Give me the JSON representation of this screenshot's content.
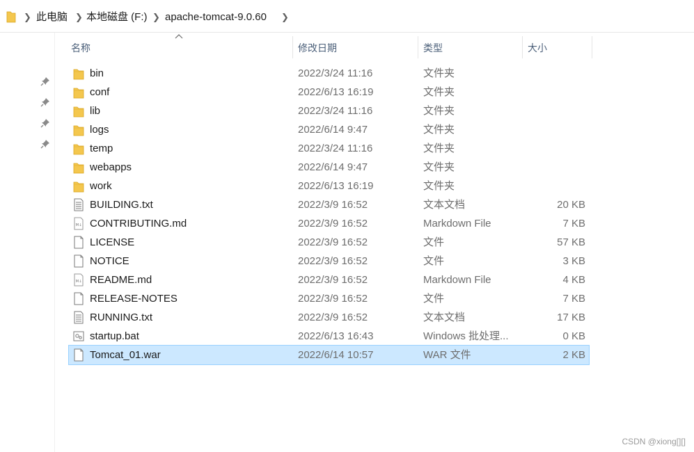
{
  "breadcrumb": {
    "items": [
      "此电脑",
      "本地磁盘 (F:)",
      "apache-tomcat-9.0.60"
    ]
  },
  "columns": {
    "name": "名称",
    "date": "修改日期",
    "type": "类型",
    "size": "大小"
  },
  "files": [
    {
      "name": "bin",
      "date": "2022/3/24 11:16",
      "type": "文件夹",
      "size": "",
      "icon": "folder-icon"
    },
    {
      "name": "conf",
      "date": "2022/6/13 16:19",
      "type": "文件夹",
      "size": "",
      "icon": "folder-icon"
    },
    {
      "name": "lib",
      "date": "2022/3/24 11:16",
      "type": "文件夹",
      "size": "",
      "icon": "folder-icon"
    },
    {
      "name": "logs",
      "date": "2022/6/14 9:47",
      "type": "文件夹",
      "size": "",
      "icon": "folder-icon"
    },
    {
      "name": "temp",
      "date": "2022/3/24 11:16",
      "type": "文件夹",
      "size": "",
      "icon": "folder-icon"
    },
    {
      "name": "webapps",
      "date": "2022/6/14 9:47",
      "type": "文件夹",
      "size": "",
      "icon": "folder-icon"
    },
    {
      "name": "work",
      "date": "2022/6/13 16:19",
      "type": "文件夹",
      "size": "",
      "icon": "folder-icon"
    },
    {
      "name": "BUILDING.txt",
      "date": "2022/3/9 16:52",
      "type": "文本文档",
      "size": "20 KB",
      "icon": "text-file-icon"
    },
    {
      "name": "CONTRIBUTING.md",
      "date": "2022/3/9 16:52",
      "type": "Markdown File",
      "size": "7 KB",
      "icon": "markdown-file-icon"
    },
    {
      "name": "LICENSE",
      "date": "2022/3/9 16:52",
      "type": "文件",
      "size": "57 KB",
      "icon": "blank-file-icon"
    },
    {
      "name": "NOTICE",
      "date": "2022/3/9 16:52",
      "type": "文件",
      "size": "3 KB",
      "icon": "blank-file-icon"
    },
    {
      "name": "README.md",
      "date": "2022/3/9 16:52",
      "type": "Markdown File",
      "size": "4 KB",
      "icon": "markdown-file-icon"
    },
    {
      "name": "RELEASE-NOTES",
      "date": "2022/3/9 16:52",
      "type": "文件",
      "size": "7 KB",
      "icon": "blank-file-icon"
    },
    {
      "name": "RUNNING.txt",
      "date": "2022/3/9 16:52",
      "type": "文本文档",
      "size": "17 KB",
      "icon": "text-file-icon"
    },
    {
      "name": "startup.bat",
      "date": "2022/6/13 16:43",
      "type": "Windows 批处理...",
      "size": "0 KB",
      "icon": "batch-file-icon"
    },
    {
      "name": "Tomcat_01.war",
      "date": "2022/6/14 10:57",
      "type": "WAR 文件",
      "size": "2 KB",
      "icon": "blank-file-icon",
      "selected": true
    }
  ],
  "nav_pins": [
    "pin-icon",
    "pin-icon",
    "pin-icon",
    "pin-icon"
  ],
  "watermark": "CSDN @xiong[][]",
  "colors": {
    "selection": "#cce8ff",
    "selection_border": "#99d1ff",
    "folder": "#f4c74e",
    "header_text": "#4c607a"
  }
}
